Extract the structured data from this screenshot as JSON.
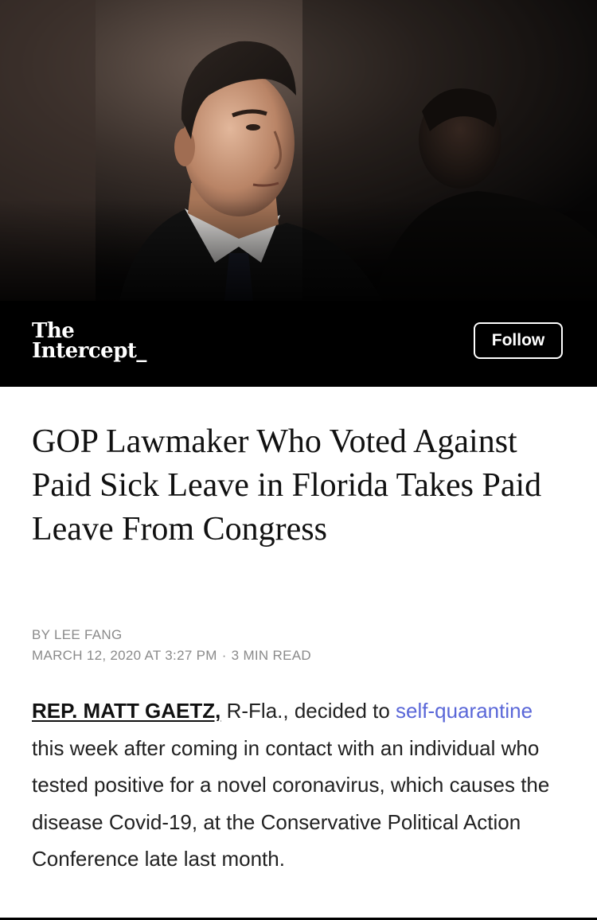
{
  "publisher": {
    "logo_line1": "The",
    "logo_line2": "Intercept_",
    "follow_label": "Follow"
  },
  "article": {
    "headline": "GOP Lawmaker Who Voted Against Paid Sick Leave in Florida Takes Paid Leave From Congress",
    "byline": "BY LEE FANG",
    "date": "MARCH 12, 2020 AT 3:27 PM",
    "separator": "·",
    "read_time": "3 MIN READ",
    "body": {
      "lead_name": "REP. MATT GAETZ,",
      "text1": " R-Fla., decided to ",
      "link_text": "self-quarantine",
      "text2": " this week after coming in contact with an individual who tested positive for a novel coronavirus, which causes the disease Covid-19, at the Conservative Political Action Conference late last month."
    }
  },
  "colors": {
    "publisher_bar": "#000000",
    "link": "#5a67d8",
    "meta_text": "#8a8a8a"
  }
}
